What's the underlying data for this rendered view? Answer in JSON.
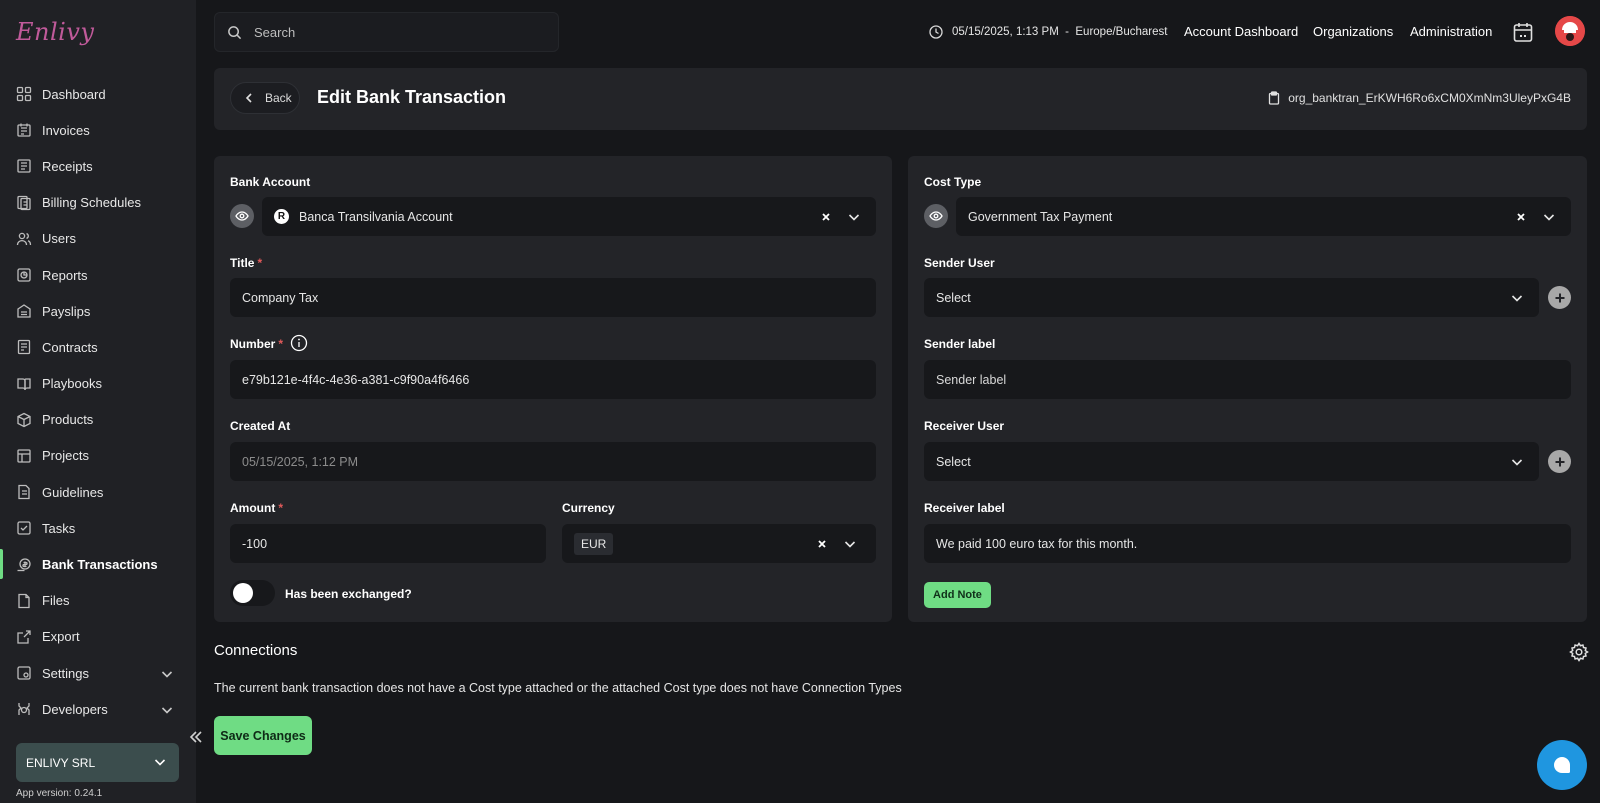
{
  "app": {
    "logo_text": "Enlivy",
    "app_version": "App version: 0.24.1"
  },
  "sidebar": {
    "items": [
      {
        "label": "Dashboard",
        "icon": "dashboard-icon"
      },
      {
        "label": "Invoices",
        "icon": "invoice-icon"
      },
      {
        "label": "Receipts",
        "icon": "receipt-icon"
      },
      {
        "label": "Billing Schedules",
        "icon": "billing-schedule-icon"
      },
      {
        "label": "Users",
        "icon": "users-icon"
      },
      {
        "label": "Reports",
        "icon": "reports-icon"
      },
      {
        "label": "Payslips",
        "icon": "payslip-icon"
      },
      {
        "label": "Contracts",
        "icon": "contract-icon"
      },
      {
        "label": "Playbooks",
        "icon": "playbook-icon"
      },
      {
        "label": "Products",
        "icon": "product-box-icon"
      },
      {
        "label": "Projects",
        "icon": "projects-icon"
      },
      {
        "label": "Guidelines",
        "icon": "guidelines-icon"
      },
      {
        "label": "Tasks",
        "icon": "tasks-icon"
      },
      {
        "label": "Bank Transactions",
        "icon": "bank-transaction-icon",
        "active": true
      },
      {
        "label": "Files",
        "icon": "file-icon"
      },
      {
        "label": "Export",
        "icon": "export-icon"
      },
      {
        "label": "Settings",
        "icon": "settings-icon",
        "expandable": true
      },
      {
        "label": "Developers",
        "icon": "developers-icon",
        "expandable": true
      }
    ],
    "organization": "ENLIVY SRL"
  },
  "topbar": {
    "search_placeholder": "Search",
    "datetime": "05/15/2025, 1:13 PM  -  Europe/Bucharest",
    "links": [
      "Account Dashboard",
      "Organizations",
      "Administration"
    ]
  },
  "header": {
    "back_label": "Back",
    "title": "Edit Bank Transaction",
    "record_id": "org_banktran_ErKWH6Ro6xCM0XmNm3UleyPxG4B"
  },
  "form": {
    "bank_account": {
      "label": "Bank Account",
      "value": "Banca Transilvania Account",
      "logo_letter": "R"
    },
    "title": {
      "label": "Title",
      "value": "Company Tax"
    },
    "number": {
      "label": "Number",
      "value": "e79b121e-4f4c-4e36-a381-c9f90a4f6466"
    },
    "created_at": {
      "label": "Created At",
      "value": "05/15/2025, 1:12 PM"
    },
    "amount": {
      "label": "Amount",
      "value": "-100"
    },
    "currency": {
      "label": "Currency",
      "value": "EUR"
    },
    "exchanged": {
      "label": "Has been exchanged?",
      "on": false
    },
    "cost_type": {
      "label": "Cost Type",
      "value": "Government Tax Payment"
    },
    "sender_user": {
      "label": "Sender User",
      "value": "Select"
    },
    "sender_label": {
      "label": "Sender label",
      "placeholder": "Sender label"
    },
    "receiver_user": {
      "label": "Receiver User",
      "value": "Select"
    },
    "receiver_label": {
      "label": "Receiver label",
      "value": "We paid 100 euro tax for this month."
    },
    "add_note_label": "Add Note"
  },
  "connections": {
    "title": "Connections",
    "message": "The current bank transaction does not have a Cost type attached or the attached Cost type does not have Connection Types"
  },
  "save_label": "Save Changes",
  "colors": {
    "accent": "#6fdc84",
    "background": "#16171a",
    "panel": "#232428",
    "chat": "#1f96e0"
  }
}
